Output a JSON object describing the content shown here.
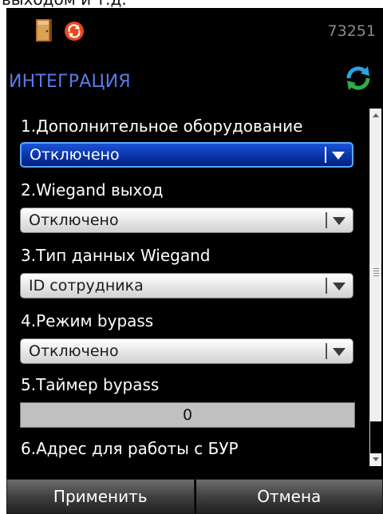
{
  "caption": "выходом и т.д.",
  "status": {
    "device_id": "73251"
  },
  "header": {
    "title": "ИНТЕГРАЦИЯ"
  },
  "fields": [
    {
      "label": "1.Дополнительное оборудование",
      "value": "Отключено"
    },
    {
      "label": "2.Wiegand выход",
      "value": "Отключено"
    },
    {
      "label": "3.Тип данных Wiegand",
      "value": "ID сотрудника"
    },
    {
      "label": "4.Режим bypass",
      "value": "Отключено"
    },
    {
      "label": "5.Таймер bypass",
      "value": "0"
    },
    {
      "label": "6.Адрес для работы с БУР"
    }
  ],
  "buttons": {
    "apply": "Применить",
    "cancel": "Отмена"
  },
  "icons": {
    "door": "door-icon",
    "orange": "sync-status-icon",
    "refresh": "refresh-icon"
  },
  "colors": {
    "title": "#5d79e8",
    "focus": "#0a34a8",
    "focus_border": "#5aa7ff"
  }
}
